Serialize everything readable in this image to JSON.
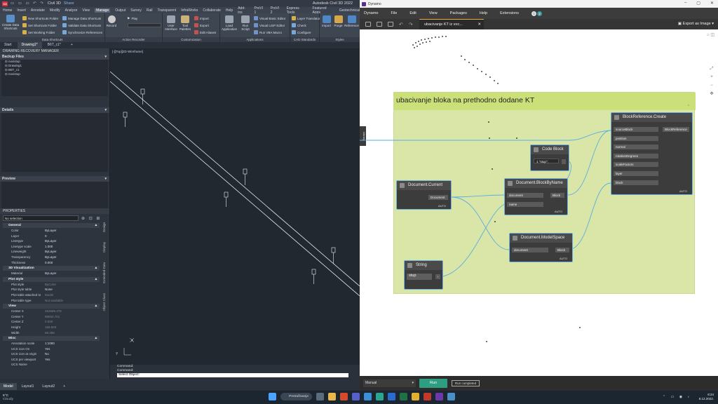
{
  "acad": {
    "title": "Civil 3D",
    "window_title": "Autodesk Civil 3D 2022",
    "share": "Share",
    "menu": [
      "Home",
      "Insert",
      "Annotate",
      "Modify",
      "Analyze",
      "View",
      "Manage",
      "Output",
      "Survey",
      "Rail",
      "Transparent",
      "InfraWorks",
      "Collaborate",
      "Help",
      "Add-ins",
      "ProVI 1",
      "ProVI 2",
      "Express Tools",
      "Featured Apps",
      "Geotechnical"
    ],
    "ribbon": {
      "data_shortcuts": {
        "title": "Data Shortcuts",
        "big": "Create Data Shortcuts",
        "items": [
          "New Shortcuts Folder",
          "Set Shortcuts Folder",
          "Set Working Folder",
          "Manage Data Shortcuts",
          "Validate Data Shortcuts",
          "Synchronize References"
        ]
      },
      "action_recorder": {
        "title": "Action Recorder",
        "big": "Record",
        "items": [
          "Play"
        ]
      },
      "customization": {
        "title": "Customization",
        "items": [
          "User Interface",
          "Tool Palettes",
          "Import",
          "Export",
          "Edit Aliases"
        ]
      },
      "applications": {
        "title": "Applications",
        "items": [
          "Load Application",
          "Run Script",
          "Visual Basic Editor",
          "Visual LISP Editor",
          "Run VBA Macro"
        ]
      },
      "cad_standards": {
        "title": "CAD Standards",
        "items": [
          "Layer Translator",
          "Check",
          "Configure"
        ]
      },
      "styles": {
        "title": "Styles",
        "items": [
          "Import",
          "Purge",
          "Reference"
        ]
      }
    },
    "doc_tabs": [
      "Start",
      "Drawing1*",
      "B6T_c1*"
    ],
    "recovery": {
      "title": "DRAWING RECOVERY MANAGER",
      "backup_files": "Backup Files",
      "files": [
        "novistup",
        "Drawing1",
        "B6T_c1",
        "novistup"
      ],
      "details": "Details",
      "preview": "Preview"
    },
    "properties": {
      "title": "PROPERTIES",
      "selection": "No selection",
      "groups": [
        {
          "name": "General",
          "rows": [
            [
              "Color",
              "ByLayer"
            ],
            [
              "Layer",
              "0"
            ],
            [
              "Linetype",
              "ByLayer"
            ],
            [
              "Linetype scale",
              "1.000"
            ],
            [
              "Lineweight",
              "ByLayer"
            ],
            [
              "Transparency",
              "ByLayer"
            ],
            [
              "Thickness",
              "0.000"
            ]
          ]
        },
        {
          "name": "3D Visualization",
          "rows": [
            [
              "Material",
              "ByLayer"
            ]
          ]
        },
        {
          "name": "Plot style",
          "rows": [
            [
              "Plot style",
              "ByColor"
            ],
            [
              "Plot style table",
              "None"
            ],
            [
              "Plot table attached to",
              "Model"
            ],
            [
              "Plot table type",
              "Not available"
            ]
          ]
        },
        {
          "name": "View",
          "rows": [
            [
              "Center X",
              "452586.376"
            ],
            [
              "Center Y",
              "98834.751"
            ],
            [
              "Center Z",
              "0.000"
            ],
            [
              "Height",
              "156.693"
            ],
            [
              "Width",
              "88.398"
            ]
          ]
        },
        {
          "name": "Misc",
          "rows": [
            [
              "Annotation scale",
              "1:1000"
            ],
            [
              "UCS icon On",
              "Yes"
            ],
            [
              "UCS icon at origin",
              "No"
            ],
            [
              "UCS per viewport",
              "Yes"
            ],
            [
              "UCS Name",
              ""
            ]
          ]
        }
      ],
      "side_tabs": [
        "Design",
        "Display",
        "Extended Data",
        "Object Class"
      ]
    },
    "viewport_label": "[-][Top][2D Wireframe]",
    "command_lines": [
      "Command:",
      "Command:"
    ],
    "command_input": "Select Object:",
    "layout_tabs": [
      "Model",
      "Layout1",
      "Layout2"
    ]
  },
  "dynamo": {
    "window_title": "Dynamo",
    "menu": [
      "Dynamo",
      "File",
      "Edit",
      "View",
      "Packages",
      "Help",
      "Extensions"
    ],
    "notification_count": "2",
    "tab": "ubacivanje KT iz exc...",
    "export": "Export as Image",
    "library": "Library",
    "group_title": "ubacivanje bloka na prethodno dodane KT",
    "nodes": {
      "document_current": {
        "title": "Document.Current",
        "out": "Document",
        "lacing": "AUTO"
      },
      "code_block": {
        "title": "Code Block",
        "code": "1 \"stup\";"
      },
      "block_by_name": {
        "title": "Document.BlockByName",
        "inputs": [
          "document",
          "name"
        ],
        "out": "Block",
        "lacing": "AUTO"
      },
      "model_space": {
        "title": "Document.ModelSpace",
        "inputs": [
          "document"
        ],
        "out": "Block",
        "lacing": "AUTO"
      },
      "string": {
        "title": "String",
        "value": "stup"
      },
      "block_ref_create": {
        "title": "BlockReference.Create",
        "inputs": [
          "sourceBlock",
          "position",
          "normal",
          "rotationDegrees",
          "scaleFactors",
          "layer",
          "block"
        ],
        "out": "BlockReference",
        "lacing": "AUTO"
      }
    },
    "run_mode": "Manual",
    "run": "Run",
    "status": "Run completed"
  },
  "taskbar": {
    "temperature": "5°C",
    "weather": "Cloudy",
    "search": "Pretraživanje",
    "time": "8:24",
    "date": "8.12.2022."
  },
  "colors": {
    "dynamo_group": "#d9e6a8",
    "dynamo_group_title": "#cbe078",
    "wire": "#5aaee0",
    "run_button": "#2e9e83",
    "acad_bg": "#212830"
  }
}
